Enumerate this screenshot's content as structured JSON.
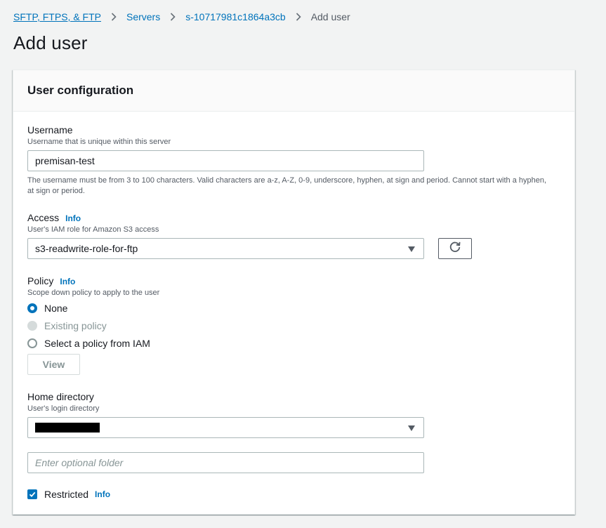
{
  "breadcrumb": {
    "items": [
      "SFTP, FTPS, & FTP",
      "Servers",
      "s-10717981c1864a3cb"
    ],
    "current": "Add user"
  },
  "page": {
    "title": "Add user"
  },
  "panel": {
    "title": "User configuration"
  },
  "username": {
    "label": "Username",
    "description": "Username that is unique within this server",
    "value": "premisan-test",
    "hint": "The username must be from 3 to 100 characters. Valid characters are a-z, A-Z, 0-9, underscore, hyphen, at sign and period. Cannot start with a hyphen, at sign or period."
  },
  "access": {
    "label": "Access",
    "info": "Info",
    "description": "User's IAM role for Amazon S3 access",
    "selected": "s3-readwrite-role-for-ftp"
  },
  "policy": {
    "label": "Policy",
    "info": "Info",
    "description": "Scope down policy to apply to the user",
    "options": [
      {
        "label": "None",
        "state": "checked"
      },
      {
        "label": "Existing policy",
        "state": "disabled"
      },
      {
        "label": "Select a policy from IAM",
        "state": "unchecked"
      }
    ],
    "view_button": "View"
  },
  "home_directory": {
    "label": "Home directory",
    "description": "User's login directory",
    "folder_placeholder": "Enter optional folder"
  },
  "restricted": {
    "label": "Restricted",
    "info": "Info",
    "checked": true
  },
  "colors": {
    "link": "#0073bb",
    "text": "#16191f",
    "muted": "#545b64",
    "background": "#f2f3f3"
  },
  "icons": [
    "chevron-right-icon",
    "refresh-icon",
    "caret-down-icon",
    "check-icon"
  ]
}
